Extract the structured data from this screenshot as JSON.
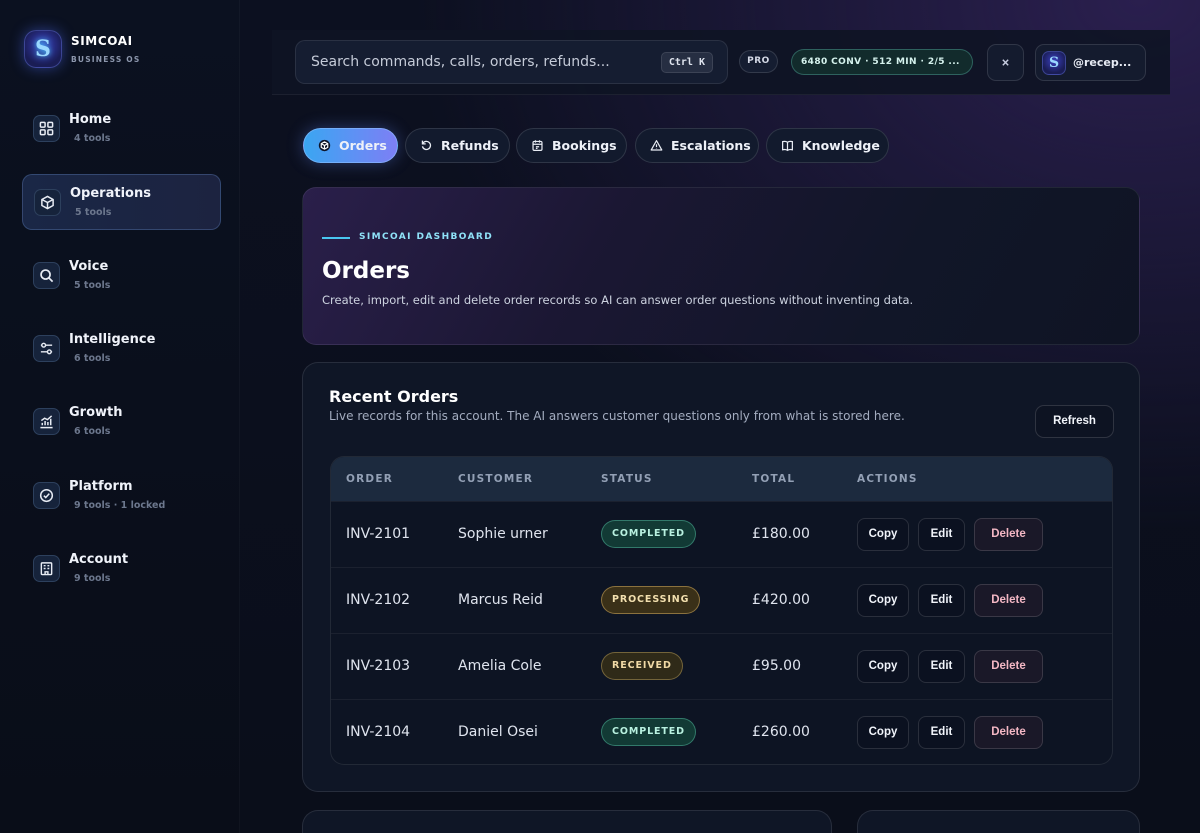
{
  "brand": {
    "name": "SIMCOAI",
    "subtitle": "BUSINESS OS",
    "logo_letter": "S"
  },
  "sidebar": {
    "items": [
      {
        "label": "Home",
        "sub": "4 tools",
        "icon": "grid-icon",
        "active": false
      },
      {
        "label": "Operations",
        "sub": "5 tools",
        "icon": "cube-icon",
        "active": true
      },
      {
        "label": "Voice",
        "sub": "5 tools",
        "icon": "search-icon",
        "active": false
      },
      {
        "label": "Intelligence",
        "sub": "6 tools",
        "icon": "sliders-icon",
        "active": false
      },
      {
        "label": "Growth",
        "sub": "6 tools",
        "icon": "chart-icon",
        "active": false
      },
      {
        "label": "Platform",
        "sub": "9 tools · 1 locked",
        "icon": "check-circle-icon",
        "active": false
      },
      {
        "label": "Account",
        "sub": "9 tools",
        "icon": "building-icon",
        "active": false
      }
    ]
  },
  "topbar": {
    "search_placeholder": "Search commands, calls, orders, refunds...",
    "shortcut": "Ctrl K",
    "plan": "PRO",
    "usage": "6480 CONV · 512 MIN · 2/5 ...",
    "icon_button": "close-icon",
    "user": "@recep...",
    "avatar_letter": "S"
  },
  "tabs": [
    {
      "label": "Orders",
      "icon": "cube-icon",
      "active": true
    },
    {
      "label": "Refunds",
      "icon": "refresh-icon",
      "active": false
    },
    {
      "label": "Bookings",
      "icon": "calendar-icon",
      "active": false
    },
    {
      "label": "Escalations",
      "icon": "warning-icon",
      "active": false
    },
    {
      "label": "Knowledge",
      "icon": "book-icon",
      "active": false
    }
  ],
  "hero": {
    "eyebrow": "SIMCOAI DASHBOARD",
    "title": "Orders",
    "description": "Create, import, edit and delete order records so AI can answer order questions without inventing data."
  },
  "orders": {
    "title": "Recent Orders",
    "subtitle": "Live records for this account. The AI answers customer questions only from what is stored here.",
    "refresh_label": "Refresh",
    "columns": [
      "ORDER",
      "CUSTOMER",
      "STATUS",
      "TOTAL",
      "ACTIONS"
    ],
    "rows": [
      {
        "order": "INV-2101",
        "customer": "Sophie urner",
        "status": "COMPLETED",
        "status_kind": "completed",
        "total": "£180.00"
      },
      {
        "order": "INV-2102",
        "customer": "Marcus Reid",
        "status": "PROCESSING",
        "status_kind": "processing",
        "total": "£420.00"
      },
      {
        "order": "INV-2103",
        "customer": "Amelia Cole",
        "status": "RECEIVED",
        "status_kind": "received",
        "total": "£95.00"
      },
      {
        "order": "INV-2104",
        "customer": "Daniel Osei",
        "status": "COMPLETED",
        "status_kind": "completed",
        "total": "£260.00"
      }
    ],
    "actions": {
      "copy": "Copy",
      "edit": "Edit",
      "delete": "Delete"
    }
  },
  "colors": {
    "accent_start": "#3aa6f2",
    "accent_end": "#7d7ff5",
    "completed": "#b9f1e0",
    "processing": "#f2dfae",
    "received": "#f0d9a5",
    "delete": "#f3b7c4"
  }
}
